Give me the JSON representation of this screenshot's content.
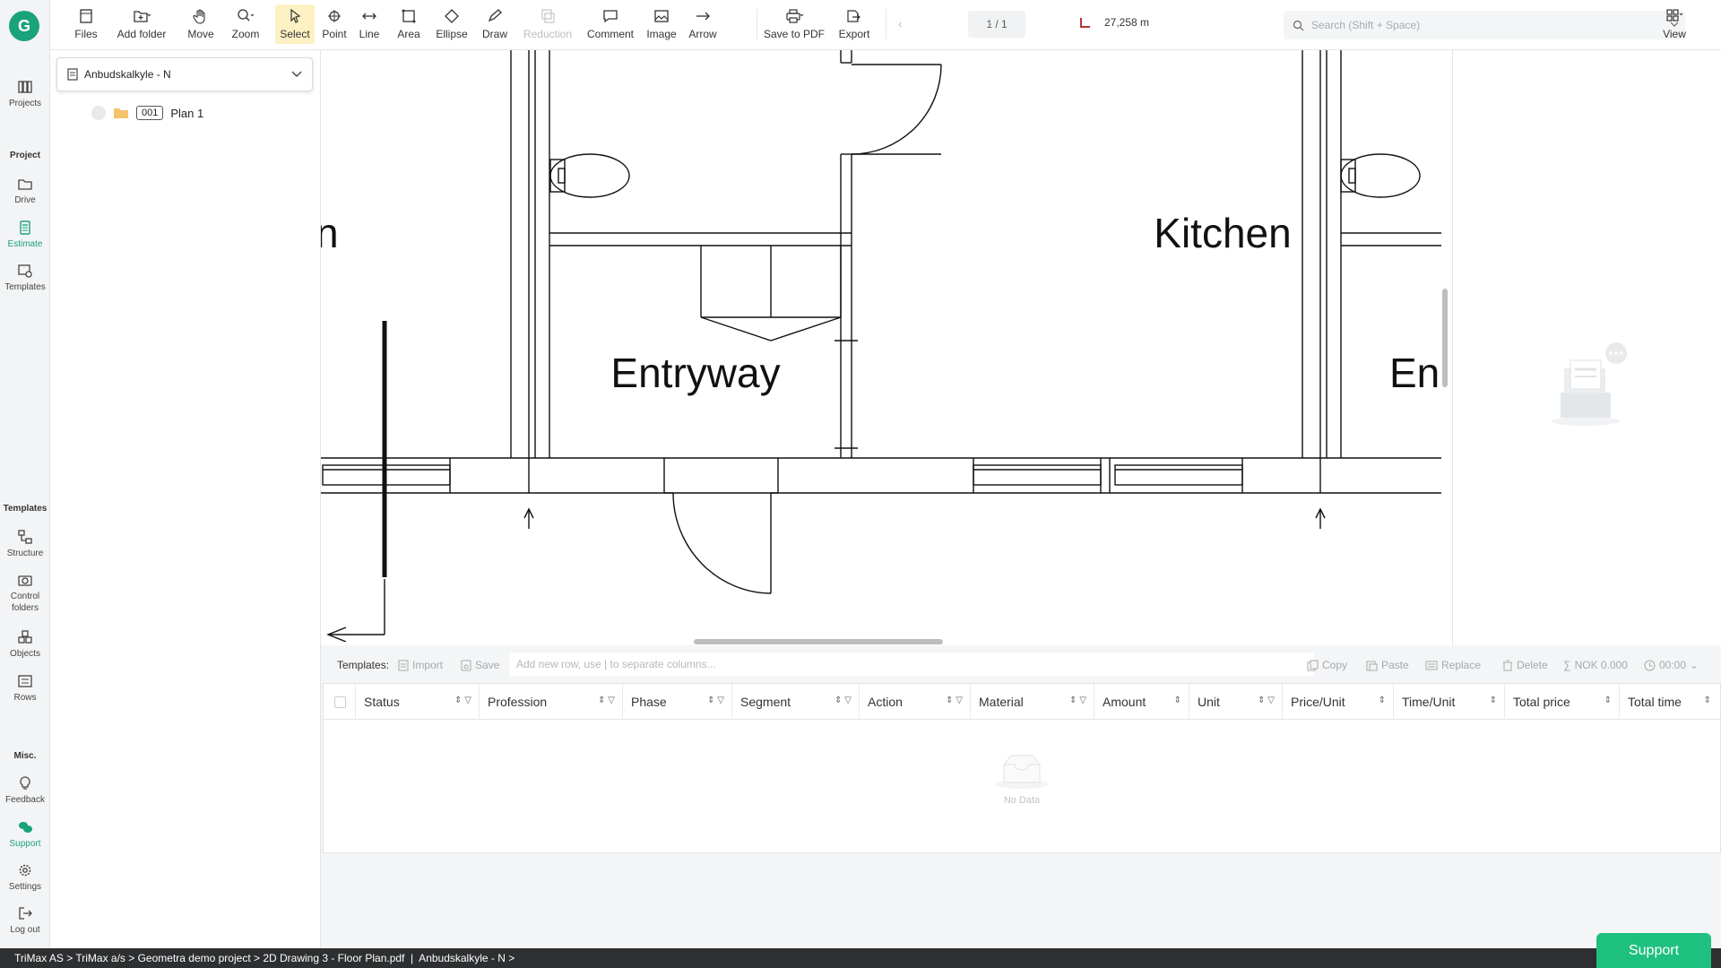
{
  "leftnav": {
    "logo": "G",
    "projects": "Projects",
    "section_project": "Project",
    "drive": "Drive",
    "estimate": "Estimate",
    "templates": "Templates",
    "section_templates": "Templates",
    "structure": "Structure",
    "control_folders_1": "Control",
    "control_folders_2": "folders",
    "objects": "Objects",
    "rows": "Rows",
    "section_misc": "Misc.",
    "feedback": "Feedback",
    "support": "Support",
    "settings": "Settings",
    "logout": "Log out"
  },
  "toolbar": {
    "files": "Files",
    "add_folder": "Add folder",
    "move": "Move",
    "zoom": "Zoom",
    "select": "Select",
    "point": "Point",
    "line": "Line",
    "area": "Area",
    "ellipse": "Ellipse",
    "draw": "Draw",
    "reduction": "Reduction",
    "comment": "Comment",
    "image": "Image",
    "arrow": "Arrow",
    "save_pdf": "Save to PDF",
    "export": "Export",
    "page": "1 / 1",
    "measurement": "27,258 m",
    "search_placeholder": "Search (Shift + Space)",
    "view": "View"
  },
  "project_panel": {
    "selected": "Anbudskalkyle - N",
    "tree_code": "001",
    "tree_label": "Plan 1"
  },
  "drawing": {
    "label_kitchen": "Kitchen",
    "label_entryway": "Entryway",
    "label_partial_right": "En",
    "label_partial_left": "n"
  },
  "templates_bar": {
    "label": "Templates:",
    "import": "Import",
    "save": "Save",
    "row_placeholder": "Add new row, use | to separate columns...",
    "copy": "Copy",
    "paste": "Paste",
    "replace": "Replace",
    "delete": "Delete",
    "total_nok": "NOK 0.000",
    "total_time": "00:00"
  },
  "grid": {
    "columns": [
      "Status",
      "Profession",
      "Phase",
      "Segment",
      "Action",
      "Material",
      "Amount",
      "Unit",
      "Price/Unit",
      "Time/Unit",
      "Total price",
      "Total time"
    ],
    "empty_text": "No Data"
  },
  "statusbar": {
    "breadcrumb": "TriMax AS > TriMax a/s > Geometra demo project > 2D Drawing 3 - Floor Plan.pdf  |  Anbudskalkyle - N >"
  },
  "support_button": "Support"
}
